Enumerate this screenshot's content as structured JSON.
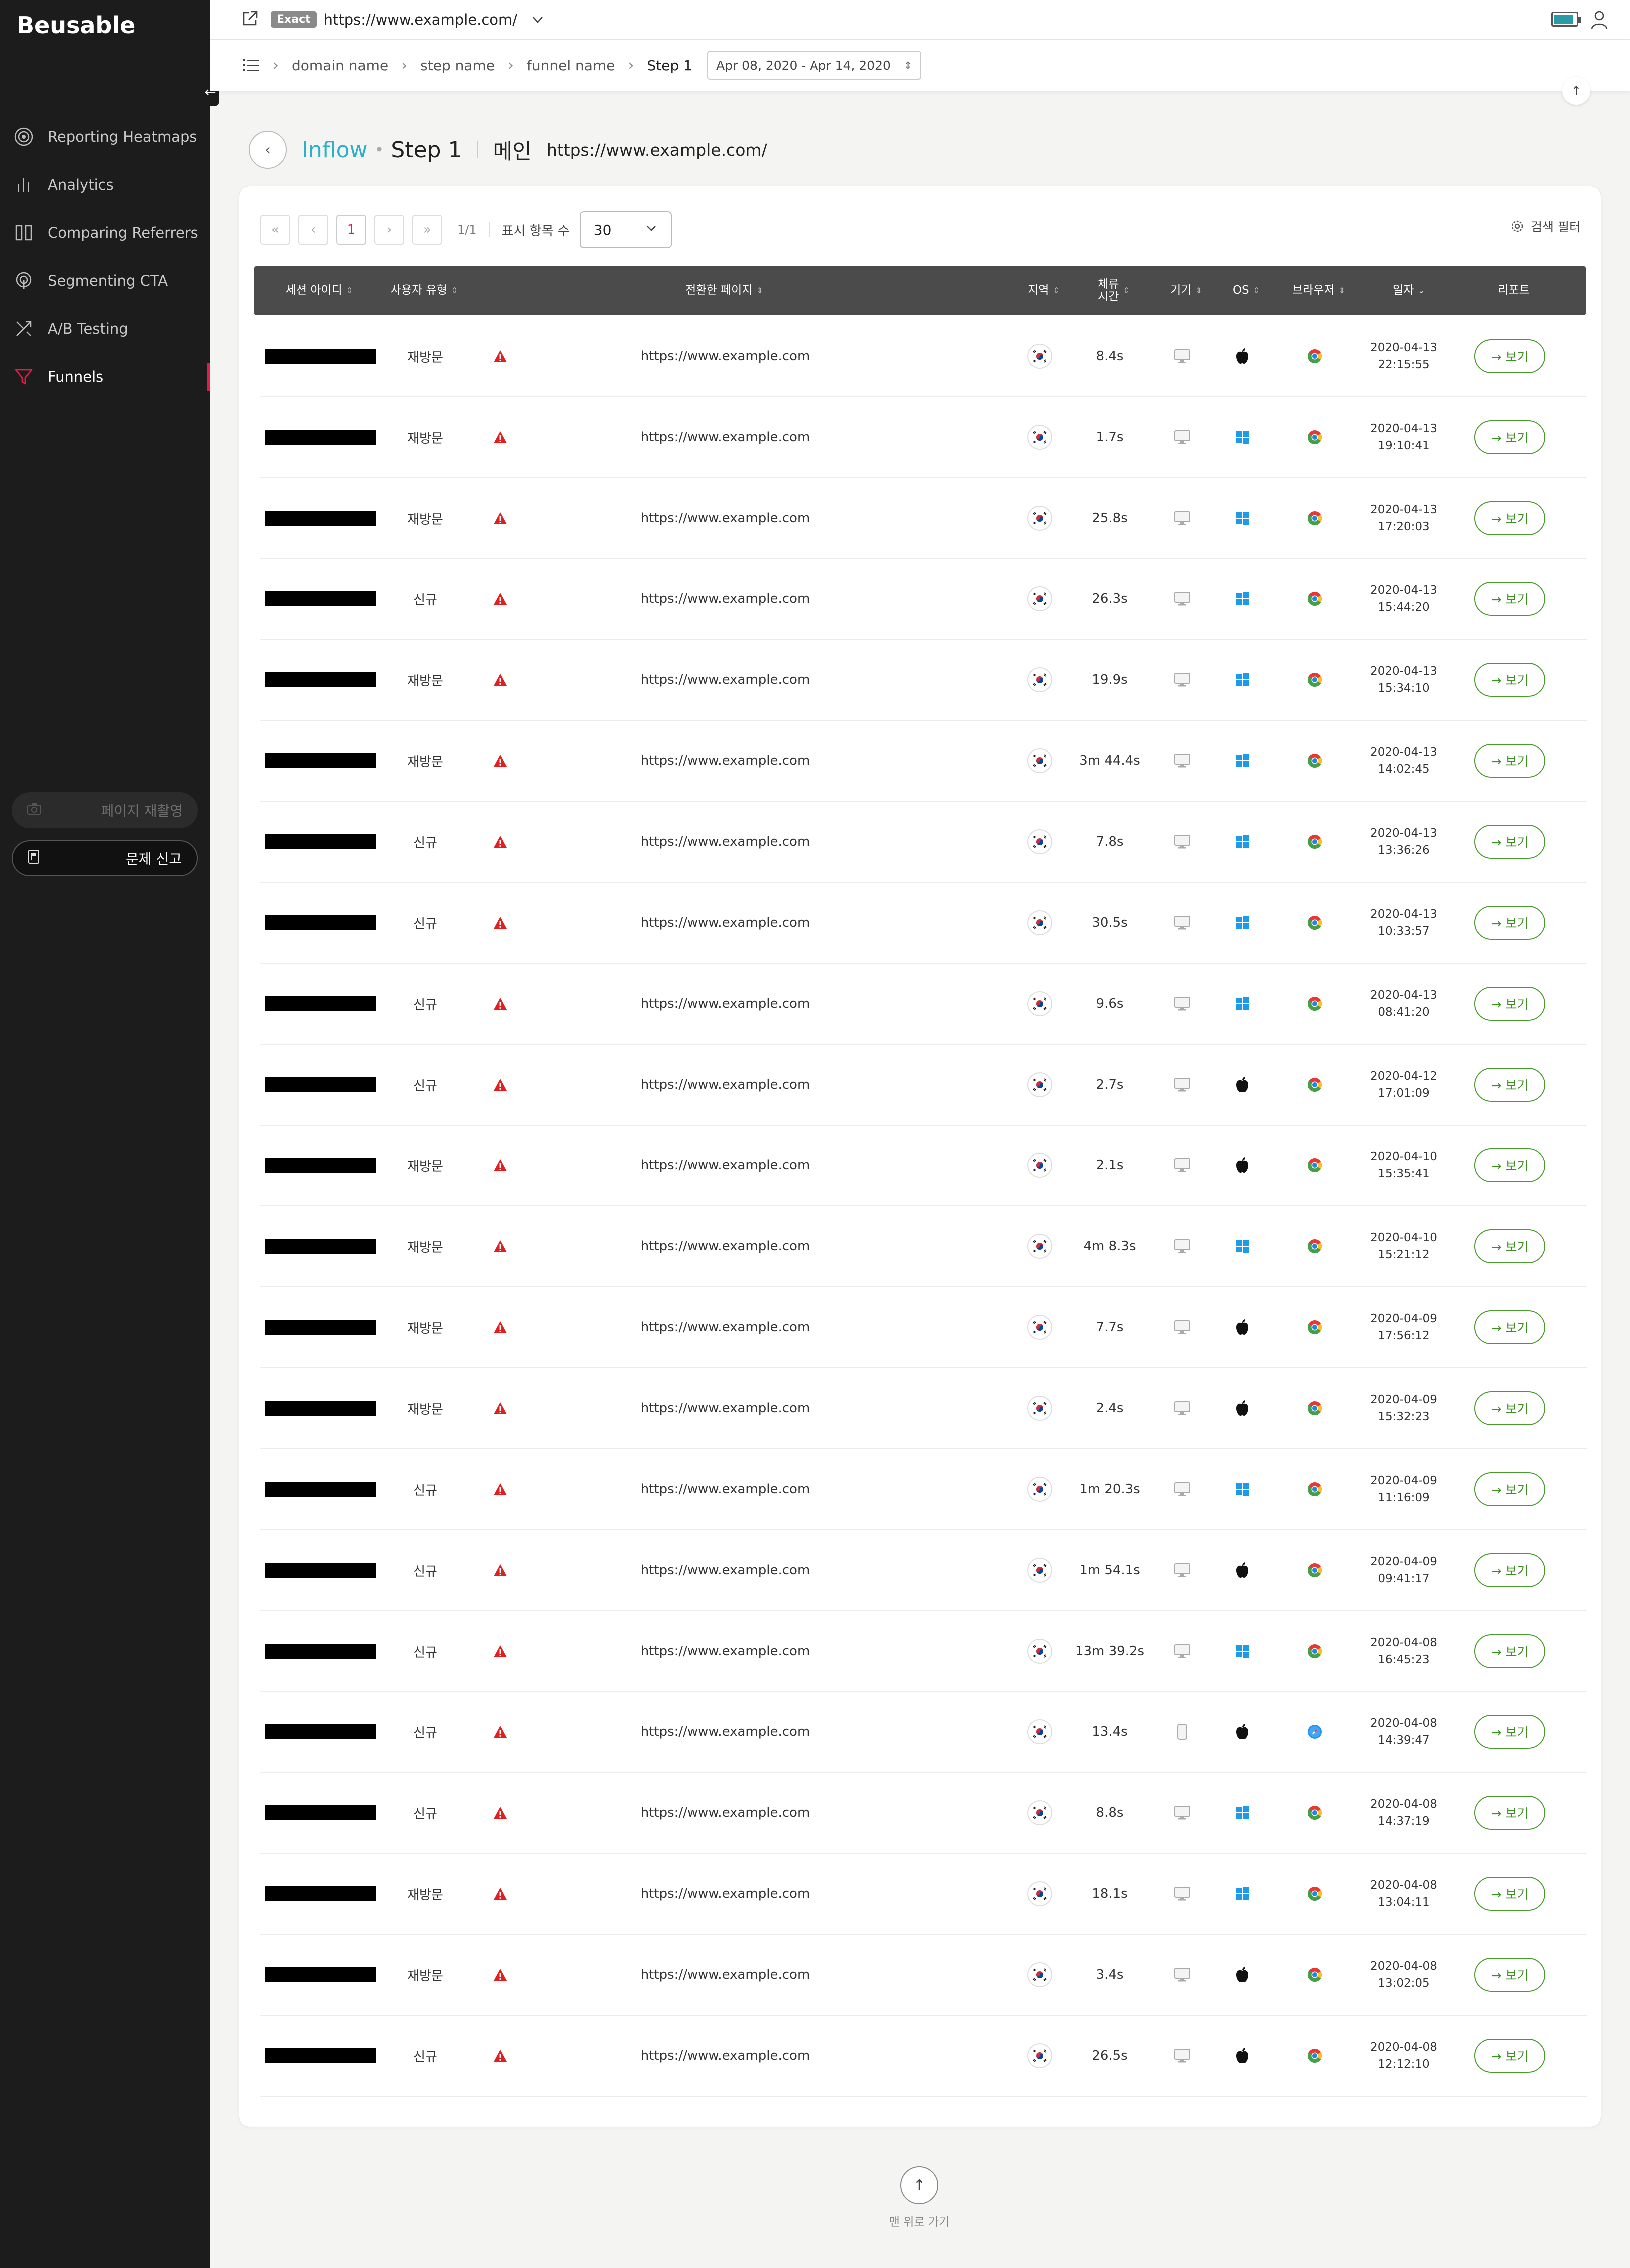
{
  "app": {
    "logo": "Beusable"
  },
  "sidebar": {
    "items": [
      {
        "label": "Reporting Heatmaps",
        "icon": "target-icon"
      },
      {
        "label": "Analytics",
        "icon": "bar-chart-icon"
      },
      {
        "label": "Comparing Referrers",
        "icon": "columns-icon"
      },
      {
        "label": "Segmenting CTA",
        "icon": "touch-icon"
      },
      {
        "label": "A/B Testing",
        "icon": "split-arrows-icon"
      },
      {
        "label": "Funnels",
        "icon": "funnel-icon",
        "active": true
      }
    ],
    "record_label": "페이지 재촬영",
    "report_label": "문제 신고"
  },
  "topbar": {
    "match_badge": "Exact",
    "url": "https://www.example.com/"
  },
  "breadcrumb": {
    "items": [
      "domain name",
      "step name",
      "funnel name",
      "Step 1"
    ],
    "date_range": "Apr 08, 2020 - Apr 14, 2020"
  },
  "title": {
    "section": "Inflow",
    "step": "Step 1",
    "page_name": "메인",
    "page_url": "https://www.example.com/"
  },
  "pager": {
    "first": "«",
    "prev": "‹",
    "current": "1",
    "next": "›",
    "last": "»",
    "info": "1/1",
    "per_page_label": "표시 항목 수",
    "per_page_value": "30",
    "filter_label": "검색 필터"
  },
  "table": {
    "headers": {
      "session": "세션 아이디",
      "user_type": "사용자 유형",
      "page": "전환한 페이지",
      "region": "지역",
      "duration": "체류\n시간",
      "device": "기기",
      "os": "OS",
      "browser": "브라우저",
      "date": "일자",
      "report": "리포트"
    },
    "view_label": "→ 보기",
    "rows": [
      {
        "user_type": "재방문",
        "page": "https://www.example.com",
        "duration": "8.4s",
        "device": "desktop",
        "os": "apple",
        "browser": "chrome",
        "date": "2020-04-13",
        "time": "22:15:55"
      },
      {
        "user_type": "재방문",
        "page": "https://www.example.com",
        "duration": "1.7s",
        "device": "desktop",
        "os": "windows",
        "browser": "chrome",
        "date": "2020-04-13",
        "time": "19:10:41"
      },
      {
        "user_type": "재방문",
        "page": "https://www.example.com",
        "duration": "25.8s",
        "device": "desktop",
        "os": "windows",
        "browser": "chrome",
        "date": "2020-04-13",
        "time": "17:20:03"
      },
      {
        "user_type": "신규",
        "page": "https://www.example.com",
        "duration": "26.3s",
        "device": "desktop",
        "os": "windows",
        "browser": "chrome",
        "date": "2020-04-13",
        "time": "15:44:20"
      },
      {
        "user_type": "재방문",
        "page": "https://www.example.com",
        "duration": "19.9s",
        "device": "desktop",
        "os": "windows",
        "browser": "chrome",
        "date": "2020-04-13",
        "time": "15:34:10"
      },
      {
        "user_type": "재방문",
        "page": "https://www.example.com",
        "duration": "3m 44.4s",
        "device": "desktop",
        "os": "windows",
        "browser": "chrome",
        "date": "2020-04-13",
        "time": "14:02:45"
      },
      {
        "user_type": "신규",
        "page": "https://www.example.com",
        "duration": "7.8s",
        "device": "desktop",
        "os": "windows",
        "browser": "chrome",
        "date": "2020-04-13",
        "time": "13:36:26"
      },
      {
        "user_type": "신규",
        "page": "https://www.example.com",
        "duration": "30.5s",
        "device": "desktop",
        "os": "windows",
        "browser": "chrome",
        "date": "2020-04-13",
        "time": "10:33:57"
      },
      {
        "user_type": "신규",
        "page": "https://www.example.com",
        "duration": "9.6s",
        "device": "desktop",
        "os": "windows",
        "browser": "chrome",
        "date": "2020-04-13",
        "time": "08:41:20"
      },
      {
        "user_type": "신규",
        "page": "https://www.example.com",
        "duration": "2.7s",
        "device": "desktop",
        "os": "apple",
        "browser": "chrome",
        "date": "2020-04-12",
        "time": "17:01:09"
      },
      {
        "user_type": "재방문",
        "page": "https://www.example.com",
        "duration": "2.1s",
        "device": "desktop",
        "os": "apple",
        "browser": "chrome",
        "date": "2020-04-10",
        "time": "15:35:41"
      },
      {
        "user_type": "재방문",
        "page": "https://www.example.com",
        "duration": "4m 8.3s",
        "device": "desktop",
        "os": "windows",
        "browser": "chrome",
        "date": "2020-04-10",
        "time": "15:21:12"
      },
      {
        "user_type": "재방문",
        "page": "https://www.example.com",
        "duration": "7.7s",
        "device": "desktop",
        "os": "apple",
        "browser": "chrome",
        "date": "2020-04-09",
        "time": "17:56:12"
      },
      {
        "user_type": "재방문",
        "page": "https://www.example.com",
        "duration": "2.4s",
        "device": "desktop",
        "os": "apple",
        "browser": "chrome",
        "date": "2020-04-09",
        "time": "15:32:23"
      },
      {
        "user_type": "신규",
        "page": "https://www.example.com",
        "duration": "1m 20.3s",
        "device": "desktop",
        "os": "windows",
        "browser": "chrome",
        "date": "2020-04-09",
        "time": "11:16:09"
      },
      {
        "user_type": "신규",
        "page": "https://www.example.com",
        "duration": "1m 54.1s",
        "device": "desktop",
        "os": "apple",
        "browser": "chrome",
        "date": "2020-04-09",
        "time": "09:41:17"
      },
      {
        "user_type": "신규",
        "page": "https://www.example.com",
        "duration": "13m 39.2s",
        "device": "desktop",
        "os": "windows",
        "browser": "chrome",
        "date": "2020-04-08",
        "time": "16:45:23"
      },
      {
        "user_type": "신규",
        "page": "https://www.example.com",
        "duration": "13.4s",
        "device": "mobile",
        "os": "apple",
        "browser": "safari",
        "date": "2020-04-08",
        "time": "14:39:47"
      },
      {
        "user_type": "신규",
        "page": "https://www.example.com",
        "duration": "8.8s",
        "device": "desktop",
        "os": "windows",
        "browser": "chrome",
        "date": "2020-04-08",
        "time": "14:37:19"
      },
      {
        "user_type": "재방문",
        "page": "https://www.example.com",
        "duration": "18.1s",
        "device": "desktop",
        "os": "windows",
        "browser": "chrome",
        "date": "2020-04-08",
        "time": "13:04:11"
      },
      {
        "user_type": "재방문",
        "page": "https://www.example.com",
        "duration": "3.4s",
        "device": "desktop",
        "os": "apple",
        "browser": "chrome",
        "date": "2020-04-08",
        "time": "13:02:05"
      },
      {
        "user_type": "신규",
        "page": "https://www.example.com",
        "duration": "26.5s",
        "device": "desktop",
        "os": "apple",
        "browser": "chrome",
        "date": "2020-04-08",
        "time": "12:12:10"
      }
    ]
  },
  "footer": {
    "to_top_label": "맨 위로 가기"
  },
  "colors": {
    "accent": "#e6194b",
    "inflow": "#2bb0c9",
    "view_button": "#4a9b2e",
    "windows": "#1e9be8",
    "warning": "#e02020"
  }
}
